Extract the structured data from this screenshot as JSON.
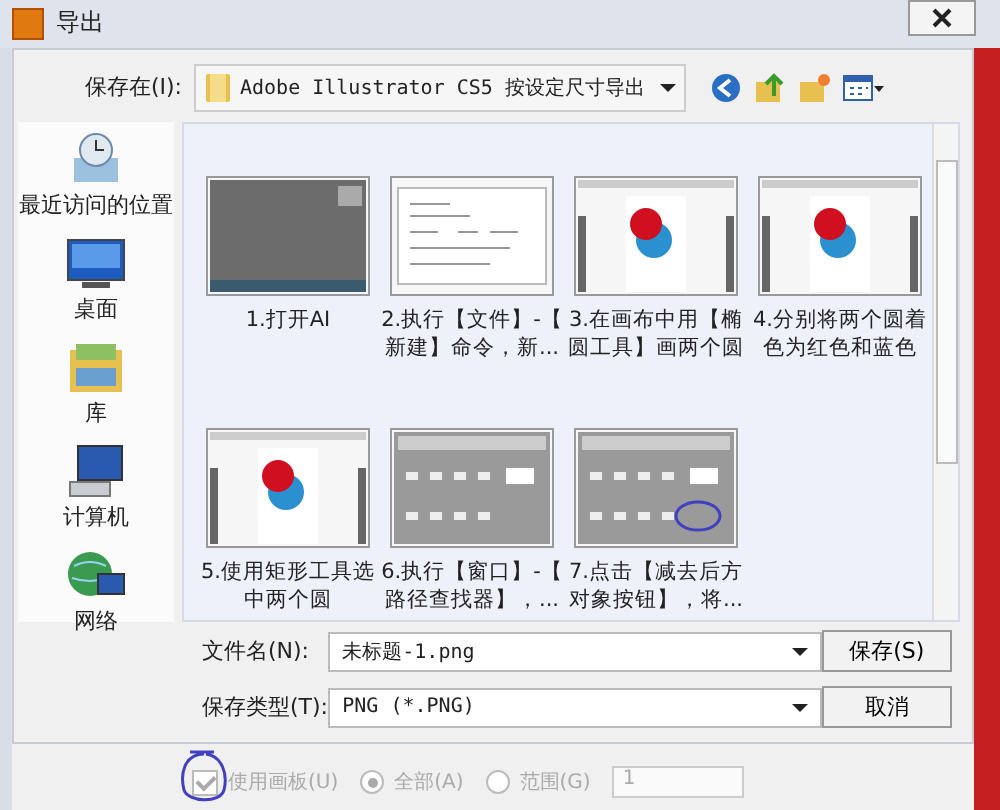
{
  "window": {
    "title": "导出"
  },
  "toolbar": {
    "label": "保存在(I):",
    "location": "Adobe Illustrator CS5 按设定尺寸导出"
  },
  "places": [
    {
      "label": "最近访问的位置",
      "kind": "recent"
    },
    {
      "label": "桌面",
      "kind": "desktop"
    },
    {
      "label": "库",
      "kind": "library"
    },
    {
      "label": "计算机",
      "kind": "computer"
    },
    {
      "label": "网络",
      "kind": "network"
    }
  ],
  "files": [
    {
      "lines": [
        "1.打开AI"
      ],
      "kind": "app",
      "circled": false
    },
    {
      "lines": [
        "2.执行【文件】-【",
        "新建】命令，新..."
      ],
      "kind": "dialog",
      "circled": false
    },
    {
      "lines": [
        "3.在画布中用【椭",
        "圆工具】画两个圆"
      ],
      "kind": "circles",
      "circled": false
    },
    {
      "lines": [
        "4.分别将两个圆着",
        "色为红色和蓝色"
      ],
      "kind": "circles",
      "circled": false
    },
    {
      "lines": [
        "5.使用矩形工具选",
        "中两个圆"
      ],
      "kind": "circles",
      "circled": false
    },
    {
      "lines": [
        "6.执行【窗口】-【",
        "路径查找器】，..."
      ],
      "kind": "panel",
      "circled": false
    },
    {
      "lines": [
        "7.点击【减去后方",
        "对象按钮】，将..."
      ],
      "kind": "panel",
      "circled": true
    }
  ],
  "form": {
    "filename_label": "文件名(N):",
    "filename": "未标题-1.png",
    "type_label": "保存类型(T):",
    "type": "PNG (*.PNG)"
  },
  "buttons": [
    "保存(S)",
    "取消"
  ],
  "options": {
    "artboard": {
      "label": "使用画板(U)",
      "checked": true,
      "circled": true
    },
    "radios": [
      {
        "label": "全部(A)",
        "selected": true
      },
      {
        "label": "范围(G)",
        "selected": false
      }
    ],
    "range": "1"
  }
}
